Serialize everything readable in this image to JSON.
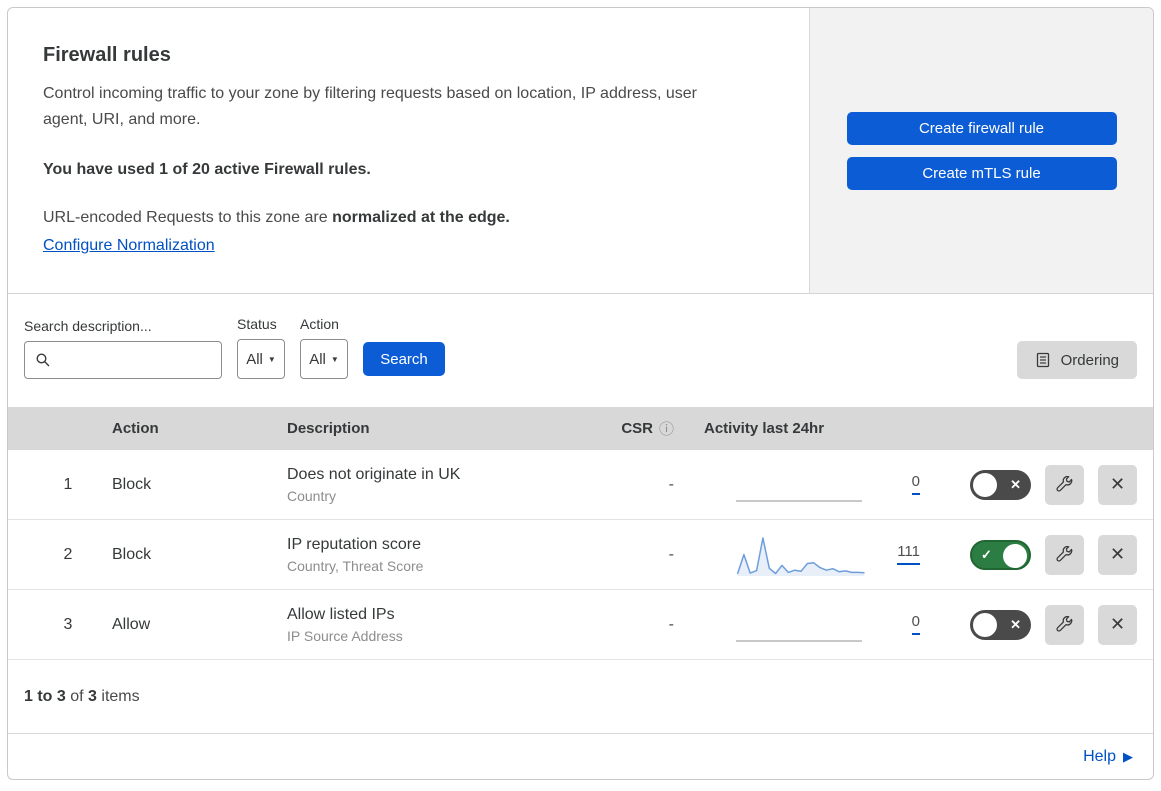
{
  "header": {
    "title": "Firewall rules",
    "description": "Control incoming traffic to your zone by filtering requests based on location, IP address, user agent, URI, and more.",
    "usage_line": "You have used 1 of 20 active Firewall rules.",
    "normalization_text": "URL-encoded Requests to this zone are",
    "normalization_bold": "normalized at the edge.",
    "normalization_link": "Configure Normalization",
    "buttons": {
      "create_firewall": "Create firewall rule",
      "create_mtls": "Create mTLS rule"
    }
  },
  "filters": {
    "search_label": "Search description...",
    "status_label": "Status",
    "status_value": "All",
    "action_label": "Action",
    "action_value": "All",
    "search_button": "Search",
    "ordering_button": "Ordering"
  },
  "table": {
    "columns": {
      "action": "Action",
      "description": "Description",
      "csr": "CSR",
      "activity": "Activity last 24hr"
    },
    "rows": [
      {
        "index": "1",
        "action": "Block",
        "description": "Does not originate in UK",
        "fields": "Country",
        "csr": "-",
        "activity_count": "0",
        "enabled": false,
        "sparkline": []
      },
      {
        "index": "2",
        "action": "Block",
        "description": "IP reputation score",
        "fields": "Country, Threat Score",
        "csr": "-",
        "activity_count": "111",
        "enabled": true,
        "sparkline": [
          3,
          55,
          5,
          12,
          100,
          18,
          4,
          26,
          7,
          13,
          10,
          31,
          33,
          20,
          13,
          17,
          9,
          11,
          7,
          7,
          6
        ]
      },
      {
        "index": "3",
        "action": "Allow",
        "description": "Allow listed IPs",
        "fields": "IP Source Address",
        "csr": "-",
        "activity_count": "0",
        "enabled": false,
        "sparkline": []
      }
    ],
    "footer": {
      "range_bold": "1 to 3",
      "of_text": "of",
      "total_bold": "3",
      "items_text": "items"
    }
  },
  "help": {
    "label": "Help"
  },
  "colors": {
    "accent_blue": "#0b5cd5",
    "link_blue": "#0051c3",
    "toggle_on_green": "#2c7d44",
    "toggle_off_gray": "#4a4a4a",
    "panel_gray": "#f2f2f2",
    "header_band_gray": "#d8d8d8",
    "sparkline_blue": "#6d9edb"
  }
}
